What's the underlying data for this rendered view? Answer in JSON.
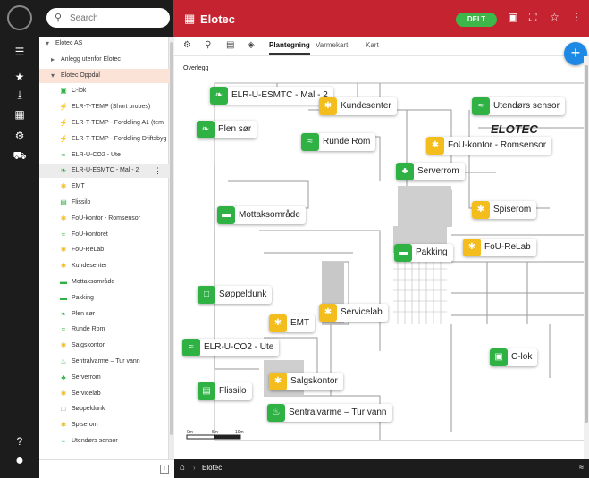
{
  "search": {
    "placeholder": "Search"
  },
  "header": {
    "title": "Elotec",
    "share_label": "DELT"
  },
  "tree": {
    "items": [
      {
        "label": "Elotec AS",
        "icon": "caret-down-icon",
        "color": "#666"
      },
      {
        "label": "Anlegg utenfor Elotec",
        "icon": "caret-right-icon",
        "color": "#666"
      },
      {
        "label": "Elotec Oppdal",
        "icon": "caret-down-icon",
        "color": "#666"
      },
      {
        "label": "C-lok",
        "icon": "door-icon",
        "color": "#2fb144"
      },
      {
        "label": "ELR-T-TEMP (Short probes)",
        "icon": "bolt-icon",
        "color": "#2fb144"
      },
      {
        "label": "ELR-T-TEMP - Fordeling A1 (tem",
        "icon": "bolt-icon",
        "color": "#2fb144"
      },
      {
        "label": "ELR-T-TEMP - Fordeling Driftsbyg",
        "icon": "bolt-icon",
        "color": "#2fb144"
      },
      {
        "label": "ELR-U-CO2 - Ute",
        "icon": "wind-icon",
        "color": "#2fb144"
      },
      {
        "label": "ELR-U-ESMTC - Mal - 2",
        "icon": "leaf-icon",
        "color": "#2fb144"
      },
      {
        "label": "EMT",
        "icon": "fan-icon",
        "color": "#f2bd1d"
      },
      {
        "label": "Flissilo",
        "icon": "silo-icon",
        "color": "#2fb144"
      },
      {
        "label": "FoU-kontor - Romsensor",
        "icon": "fan-icon",
        "color": "#f2bd1d"
      },
      {
        "label": "FoU-kontoret",
        "icon": "wind-icon",
        "color": "#2fb144"
      },
      {
        "label": "FoU-ReLab",
        "icon": "fan-icon",
        "color": "#f2bd1d"
      },
      {
        "label": "Kundesenter",
        "icon": "fan-icon",
        "color": "#f2bd1d"
      },
      {
        "label": "Mottaksområde",
        "icon": "truck-icon",
        "color": "#2fb144"
      },
      {
        "label": "Pakking",
        "icon": "truck-icon",
        "color": "#2fb144"
      },
      {
        "label": "Plen sør",
        "icon": "leaf-icon",
        "color": "#2fb144"
      },
      {
        "label": "Runde Rom",
        "icon": "wind-icon",
        "color": "#2fb144"
      },
      {
        "label": "Salgskontor",
        "icon": "fan-icon",
        "color": "#f2bd1d"
      },
      {
        "label": "Sentralvarme – Tur vann",
        "icon": "heat-icon",
        "color": "#2fb144"
      },
      {
        "label": "Serverrom",
        "icon": "server-icon",
        "color": "#2fb144"
      },
      {
        "label": "Servicelab",
        "icon": "fan-icon",
        "color": "#f2bd1d"
      },
      {
        "label": "Søppeldunk",
        "icon": "bin-icon",
        "color": "#2fb144"
      },
      {
        "label": "Spiserom",
        "icon": "fan-icon",
        "color": "#f2bd1d"
      },
      {
        "label": "Utendørs sensor",
        "icon": "wind-icon",
        "color": "#2fb144"
      }
    ]
  },
  "tabs": {
    "items": [
      {
        "label": "Plantegning",
        "active": true
      },
      {
        "label": "Varmekart",
        "active": false
      },
      {
        "label": "Kart",
        "active": false
      }
    ]
  },
  "canvas": {
    "overlay_label": "Overlegg",
    "brand": "ELOTEC",
    "scale": {
      "a": "0m",
      "b": "5m",
      "c": "10m"
    }
  },
  "sensors": [
    {
      "label": "ELR-U-ESMTC - Mal - 2",
      "color": "green",
      "icon": "leaf-icon"
    },
    {
      "label": "Kundesenter",
      "color": "yellow",
      "icon": "fan-icon"
    },
    {
      "label": "Utendørs sensor",
      "color": "green",
      "icon": "wind-icon"
    },
    {
      "label": "Plen sør",
      "color": "green",
      "icon": "leaf-icon"
    },
    {
      "label": "Runde Rom",
      "color": "green",
      "icon": "wind-icon"
    },
    {
      "label": "FoU-kontor - Romsensor",
      "color": "yellow",
      "icon": "fan-icon"
    },
    {
      "label": "Serverrom",
      "color": "green",
      "icon": "server-icon"
    },
    {
      "label": "Mottaksområde",
      "color": "green",
      "icon": "truck-icon"
    },
    {
      "label": "Spiserom",
      "color": "yellow",
      "icon": "fan-icon"
    },
    {
      "label": "FoU-ReLab",
      "color": "yellow",
      "icon": "fan-icon"
    },
    {
      "label": "Pakking",
      "color": "green",
      "icon": "truck-icon"
    },
    {
      "label": "Søppeldunk",
      "color": "green",
      "icon": "bin-icon"
    },
    {
      "label": "Servicelab",
      "color": "yellow",
      "icon": "fan-icon"
    },
    {
      "label": "EMT",
      "color": "yellow",
      "icon": "fan-icon"
    },
    {
      "label": "ELR-U-CO2 - Ute",
      "color": "green",
      "icon": "wind-icon"
    },
    {
      "label": "C-lok",
      "color": "green",
      "icon": "door-icon"
    },
    {
      "label": "Salgskontor",
      "color": "yellow",
      "icon": "fan-icon"
    },
    {
      "label": "Flissilo",
      "color": "green",
      "icon": "silo-icon"
    },
    {
      "label": "Sentralvarme – Tur vann",
      "color": "green",
      "icon": "heat-icon"
    }
  ],
  "breadcrumb": {
    "current": "Elotec"
  },
  "colors": {
    "brand_red": "#c4232f",
    "rail": "#1c1c1c",
    "ok_green": "#2fb144",
    "warn_yellow": "#f2bd1d",
    "fab_blue": "#1e88e5"
  }
}
